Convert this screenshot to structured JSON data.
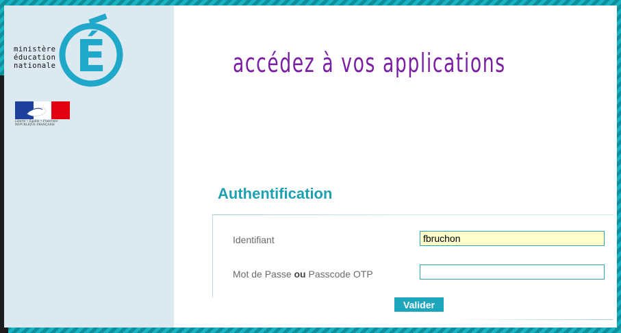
{
  "branding": {
    "ministry_lines": [
      "ministère",
      "éducation",
      "nationale"
    ],
    "logo_letter": "É",
    "rf_motto": "Liberté • Égalité • Fraternité",
    "rf_name": "RÉPUBLIQUE FRANÇAISE"
  },
  "header": {
    "title": "accédez à vos applications"
  },
  "auth": {
    "title": "Authentification",
    "identifiant_label": "Identifiant",
    "identifiant_value": "fbruchon",
    "password_label_pre": "Mot de Passe ",
    "password_label_bold": "ou",
    "password_label_post": " Passcode OTP",
    "password_value": "",
    "submit_label": "Valider"
  },
  "colors": {
    "accent": "#1fa0b0",
    "title_purple": "#7a1fa2",
    "sidebar_bg": "#dde9f0",
    "input_highlight": "#ffffcc"
  }
}
